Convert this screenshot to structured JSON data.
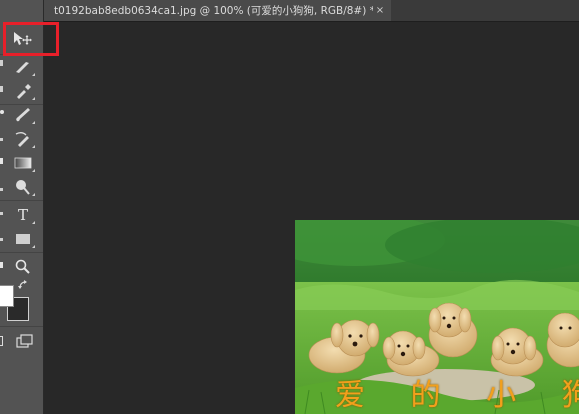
{
  "document_tab": {
    "title": "t0192bab8edb0634ca1.jpg @ 100% (可爱的小狗狗, RGB/8#) *",
    "close_glyph": "×"
  },
  "colors": {
    "highlight": "#e8202a",
    "foreground_swatch": "#ffffff",
    "background_swatch": "#2a2a2a"
  },
  "toolbar": {
    "tools": [
      {
        "name": "move-tool",
        "icon": "move-icon"
      },
      {
        "name": "brush-variant",
        "icon": "brush-icon"
      },
      {
        "name": "eyedropper",
        "icon": "eyedropper-icon"
      },
      {
        "name": "brush",
        "icon": "brush-icon"
      },
      {
        "name": "history-brush",
        "icon": "history-brush-icon"
      },
      {
        "name": "gradient",
        "icon": "gradient-icon"
      },
      {
        "name": "dodge",
        "icon": "dodge-icon"
      },
      {
        "name": "type",
        "icon": "type-icon",
        "glyph": "T"
      },
      {
        "name": "rectangle",
        "icon": "rectangle-icon"
      },
      {
        "name": "zoom",
        "icon": "zoom-icon"
      }
    ]
  },
  "image_caption": "爱 的 小 狗"
}
